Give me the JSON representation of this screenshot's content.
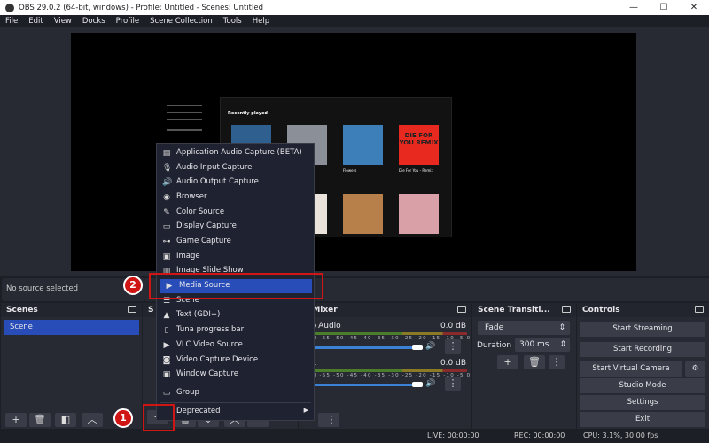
{
  "window": {
    "title": "OBS 29.0.2 (64-bit, windows) - Profile: Untitled - Scenes: Untitled",
    "min": "—",
    "max": "☐",
    "close": "✕"
  },
  "menu": [
    "File",
    "Edit",
    "View",
    "Docks",
    "Profile",
    "Scene Collection",
    "Tools",
    "Help"
  ],
  "source_bar": {
    "status": "No source selected"
  },
  "scenes": {
    "title": "Scenes",
    "items": [
      "Scene"
    ]
  },
  "sources": {
    "title": "S"
  },
  "context_menu": {
    "items": [
      "Application Audio Capture (BETA)",
      "Audio Input Capture",
      "Audio Output Capture",
      "Browser",
      "Color Source",
      "Display Capture",
      "Game Capture",
      "Image",
      "Image Slide Show",
      "Media Source",
      "Scene",
      "Text (GDI+)",
      "Tuna progress bar",
      "VLC Video Source",
      "Video Capture Device",
      "Window Capture"
    ],
    "group": "Group",
    "deprecated": "Deprecated",
    "selected": "Media Source"
  },
  "audio_mixer": {
    "title": "Audio Mixer",
    "title_visible": "o Mixer",
    "channels": [
      {
        "name": "op Audio",
        "db": "0.0 dB"
      },
      {
        "name": "ux",
        "db": "0.0 dB"
      }
    ],
    "ticks": "-60 -55 -50 -45 -40 -35 -30 -25 -20 -15 -10 -5 0"
  },
  "transitions": {
    "title": "Scene Transiti...",
    "type": "Fade",
    "duration_label": "Duration",
    "duration": "300 ms"
  },
  "controls": {
    "title": "Controls",
    "buttons": [
      "Start Streaming",
      "Start Recording",
      "Start Virtual Camera",
      "Studio Mode",
      "Settings",
      "Exit"
    ]
  },
  "status": {
    "live": "LIVE: 00:00:00",
    "rec": "REC: 00:00:00",
    "cpu": "CPU: 3.1%, 30.00 fps"
  },
  "annotations": {
    "step1": "1",
    "step2": "2"
  },
  "preview": {
    "section": "Recently played",
    "album": "DIE FOR YOU REMIX",
    "tracks": [
      "Flowers",
      "Die For You - Remix"
    ]
  },
  "colors": {
    "accent": "#284cb8",
    "annotation": "#d01515"
  }
}
